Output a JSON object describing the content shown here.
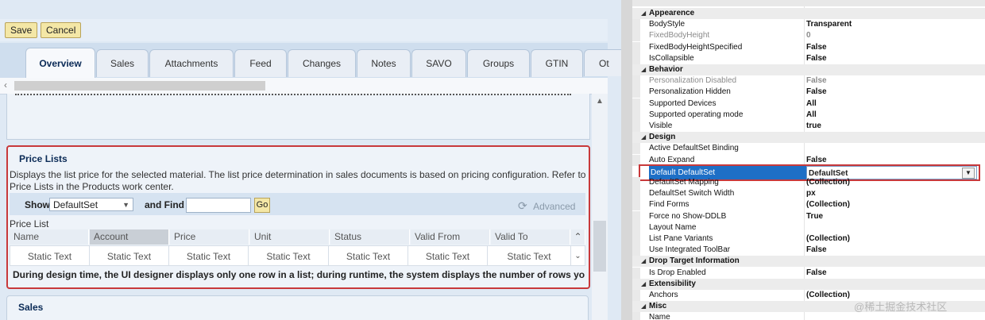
{
  "toolbar": {
    "save_label": "Save",
    "cancel_label": "Cancel"
  },
  "tabs": [
    "Overview",
    "Sales",
    "Attachments",
    "Feed",
    "Changes",
    "Notes",
    "SAVO",
    "Groups",
    "GTIN",
    "Ot"
  ],
  "price_lists": {
    "title": "Price Lists",
    "description": "Displays the list price for the selected material. The list price determination in sales documents is based on pricing configuration. Refer to Price Lists in the Products work center.",
    "show_label": "Show",
    "show_value": "DefaultSet",
    "and_find_label": "and  Find",
    "find_value": "",
    "go_label": "Go",
    "advanced_label": "Advanced",
    "list_label": "Price List",
    "columns": [
      "Name",
      "Account",
      "Price",
      "Unit",
      "Status",
      "Valid From",
      "Valid To"
    ],
    "row": [
      "Static Text",
      "Static Text",
      "Static Text",
      "Static Text",
      "Static Text",
      "Static Text",
      "Static Text"
    ],
    "note": "During design time, the UI designer displays only one row in a list; during runtime, the system displays the number of rows yo"
  },
  "sales_section": {
    "title": "Sales"
  },
  "properties": {
    "categories": [
      {
        "name": "Appearence",
        "items": [
          {
            "name": "BodyStyle",
            "value": "Transparent"
          },
          {
            "name": "FixedBodyHeight",
            "value": "0",
            "grey": true
          },
          {
            "name": "FixedBodyHeightSpecified",
            "value": "False"
          },
          {
            "name": "IsCollapsible",
            "value": "False"
          }
        ]
      },
      {
        "name": "Behavior",
        "items": [
          {
            "name": "Personalization Disabled",
            "value": "False",
            "grey": true
          },
          {
            "name": "Personalization Hidden",
            "value": "False"
          },
          {
            "name": "Supported Devices",
            "value": "All"
          },
          {
            "name": "Supported operating mode",
            "value": "All"
          },
          {
            "name": "Visible",
            "value": "true"
          }
        ]
      },
      {
        "name": "Design",
        "items": [
          {
            "name": "Active DefaultSet Binding",
            "value": ""
          },
          {
            "name": "Auto Expand",
            "value": "False"
          },
          {
            "name": "Default DefaultSet",
            "value": "DefaultSet",
            "selected": true
          },
          {
            "name": "DefaultSet Mapping",
            "value": "(Collection)"
          },
          {
            "name": "DefaultSet Switch Width",
            "value": "px"
          },
          {
            "name": "Find Forms",
            "value": "(Collection)"
          },
          {
            "name": "Force no Show-DDLB",
            "value": "True"
          },
          {
            "name": "Layout Name",
            "value": ""
          },
          {
            "name": "List Pane Variants",
            "value": "(Collection)"
          },
          {
            "name": "Use Integrated ToolBar",
            "value": "False"
          }
        ]
      },
      {
        "name": "Drop Target Information",
        "items": [
          {
            "name": "Is Drop Enabled",
            "value": "False"
          }
        ]
      },
      {
        "name": "Extensibility",
        "items": [
          {
            "name": "Anchors",
            "value": "(Collection)"
          }
        ]
      },
      {
        "name": "Misc",
        "items": [
          {
            "name": "Name",
            "value": ""
          }
        ]
      }
    ]
  },
  "watermark": "@稀土掘金技术社区"
}
